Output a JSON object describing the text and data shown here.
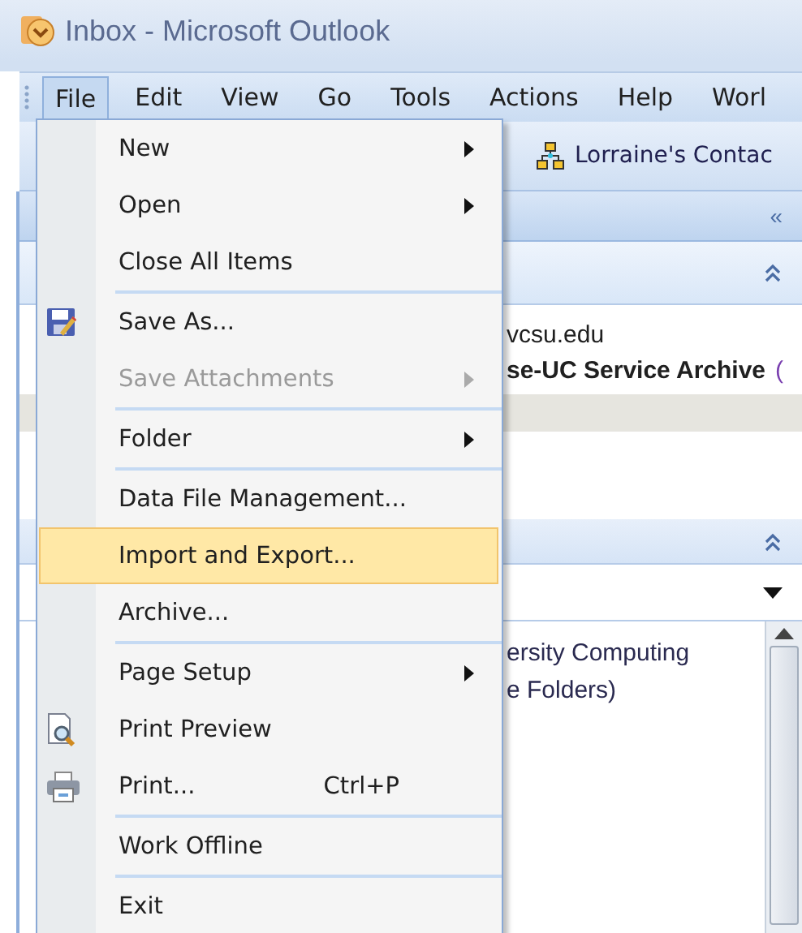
{
  "window": {
    "title": "Inbox - Microsoft Outlook"
  },
  "menubar": [
    {
      "label": "File",
      "selected": true
    },
    {
      "label": "Edit",
      "selected": false
    },
    {
      "label": "View",
      "selected": false
    },
    {
      "label": "Go",
      "selected": false
    },
    {
      "label": "Tools",
      "selected": false
    },
    {
      "label": "Actions",
      "selected": false
    },
    {
      "label": "Help",
      "selected": false
    },
    {
      "label": "Worl",
      "selected": false
    }
  ],
  "toolbar": {
    "contacts_button": "Lorraine's Contac"
  },
  "background": {
    "collapse_button": "«",
    "address": "vcsu.edu",
    "folder": "se-UC Service Archive",
    "folder_count": "(",
    "tree": [
      "ersity Computing",
      "e Folders)"
    ]
  },
  "file_menu": [
    {
      "kind": "item",
      "label": "New",
      "submenu": true,
      "disabled": false,
      "selected": false
    },
    {
      "kind": "item",
      "label": "Open",
      "submenu": true,
      "disabled": false,
      "selected": false
    },
    {
      "kind": "item",
      "label": "Close All Items",
      "submenu": false,
      "disabled": false,
      "selected": false
    },
    {
      "kind": "separator"
    },
    {
      "kind": "item",
      "label": "Save As...",
      "submenu": false,
      "disabled": false,
      "selected": false
    },
    {
      "kind": "item",
      "label": "Save Attachments",
      "submenu": true,
      "disabled": true,
      "selected": false
    },
    {
      "kind": "separator"
    },
    {
      "kind": "item",
      "label": "Folder",
      "submenu": true,
      "disabled": false,
      "selected": false
    },
    {
      "kind": "separator"
    },
    {
      "kind": "item",
      "label": "Data File Management...",
      "submenu": false,
      "disabled": false,
      "selected": false
    },
    {
      "kind": "item",
      "label": "Import and Export...",
      "submenu": false,
      "disabled": false,
      "selected": true
    },
    {
      "kind": "item",
      "label": "Archive...",
      "submenu": false,
      "disabled": false,
      "selected": false
    },
    {
      "kind": "separator"
    },
    {
      "kind": "item",
      "label": "Page Setup",
      "submenu": true,
      "disabled": false,
      "selected": false
    },
    {
      "kind": "item",
      "label": "Print Preview",
      "submenu": false,
      "disabled": false,
      "selected": false
    },
    {
      "kind": "item",
      "label": "Print...",
      "shortcut": "Ctrl+P",
      "submenu": false,
      "disabled": false,
      "selected": false
    },
    {
      "kind": "separator"
    },
    {
      "kind": "item",
      "label": "Work Offline",
      "submenu": false,
      "disabled": false,
      "selected": false
    },
    {
      "kind": "separator"
    },
    {
      "kind": "item",
      "label": "Exit",
      "submenu": false,
      "disabled": false,
      "selected": false
    }
  ]
}
